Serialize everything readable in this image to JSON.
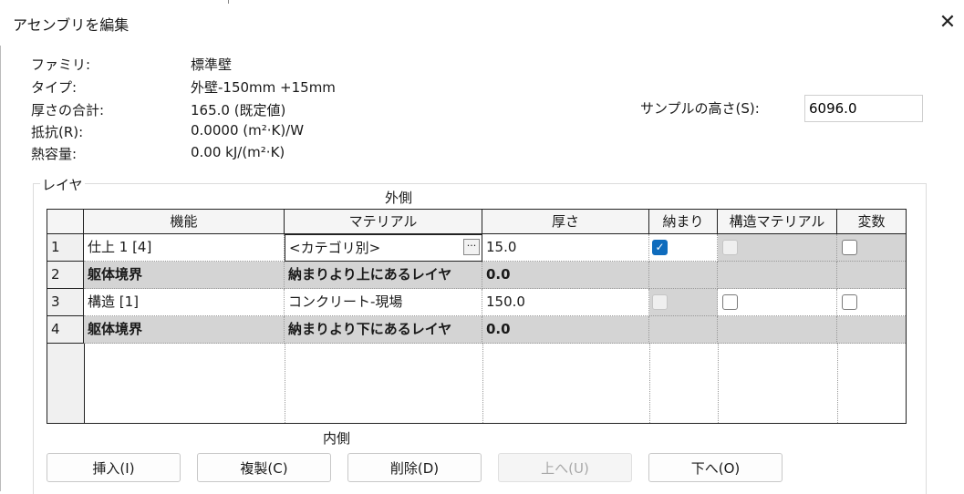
{
  "window": {
    "title": "アセンブリを編集",
    "close_glyph": "✕"
  },
  "info": {
    "family_label": "ファミリ:",
    "family_value": "標準壁",
    "type_label": "タイプ:",
    "type_value": "外壁-150mm +15mm",
    "thickness_label": "厚さの合計:",
    "thickness_value": "165.0 (既定値)",
    "resistance_label": "抵抗(R):",
    "resistance_value": "0.0000 (m²·K)/W",
    "thermal_mass_label": "熱容量:",
    "thermal_mass_value": "0.00 kJ/(m²·K)"
  },
  "sample_height": {
    "label": "サンプルの高さ(S):",
    "value": "6096.0"
  },
  "layers": {
    "group_label": "レイヤ",
    "exterior_label": "外側",
    "interior_label": "内側",
    "columns": [
      "機能",
      "マテリアル",
      "厚さ",
      "納まり",
      "構造マテリアル",
      "変数"
    ],
    "rows": [
      {
        "num": "1",
        "function": "仕上 1 [4]",
        "material": "<カテゴリ別>",
        "thickness": "15.0",
        "wraps": "checked",
        "structural": "disabled",
        "variable": "unchecked"
      },
      {
        "num": "2",
        "function": "躯体境界",
        "material": "納まりより上にあるレイヤ",
        "thickness": "0.0",
        "wraps": "none",
        "structural": "none",
        "variable": "none"
      },
      {
        "num": "3",
        "function": "構造 [1]",
        "material": "コンクリート-現場",
        "thickness": "150.0",
        "wraps": "disabled",
        "structural": "unchecked",
        "variable": "unchecked"
      },
      {
        "num": "4",
        "function": "躯体境界",
        "material": "納まりより下にあるレイヤ",
        "thickness": "0.0",
        "wraps": "none",
        "structural": "none",
        "variable": "none"
      }
    ],
    "material_browse_glyph": "···"
  },
  "buttons": {
    "insert": "挿入(I)",
    "duplicate": "複製(C)",
    "delete": "削除(D)",
    "up": "上へ(U)",
    "down": "下へ(O)"
  },
  "colors": {
    "accent": "#0f6cbd",
    "boundary_row": "#d4d4d4"
  }
}
